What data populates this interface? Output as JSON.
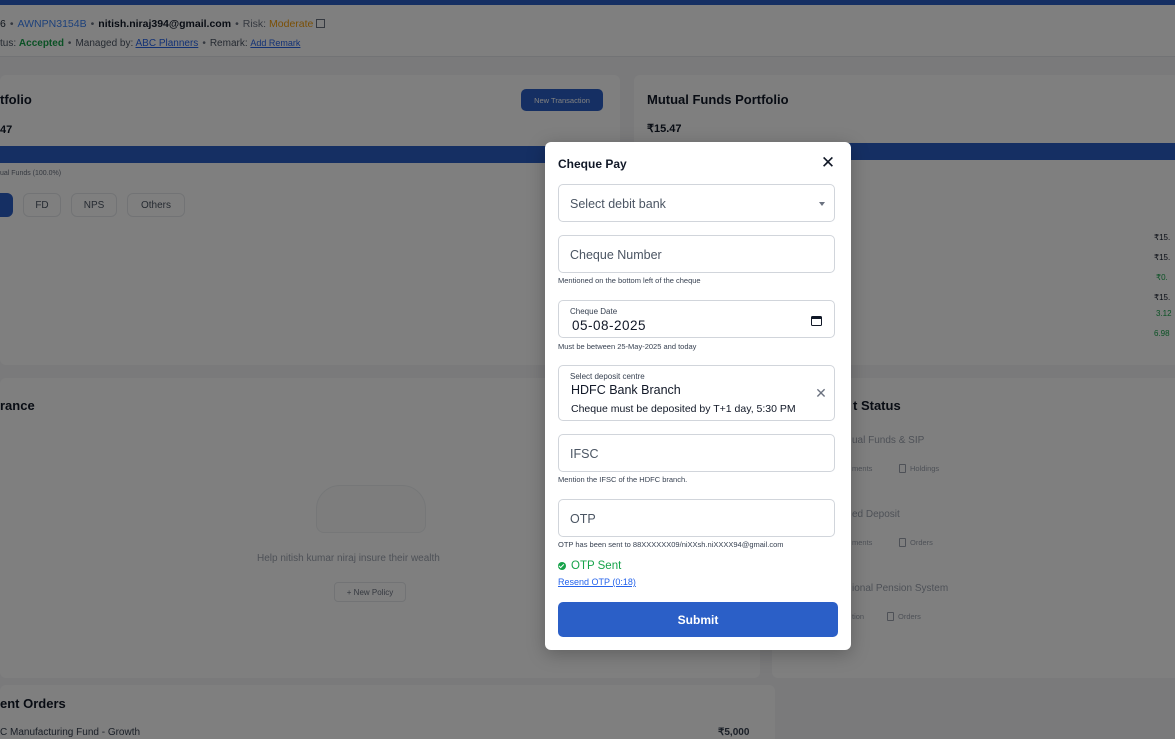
{
  "client": {
    "id_fragment": "6",
    "pan": "AWNPN3154B",
    "email": "nitish.niraj394@gmail.com",
    "risk_label": "Risk:",
    "risk_value": "Moderate",
    "status_label": "tus:",
    "status_value": "Accepted",
    "managed_by_label": "Managed by:",
    "managed_by_value": "ABC Planners",
    "remark_label": "Remark:",
    "remark_link": "Add Remark"
  },
  "portfolio": {
    "title": "tfolio",
    "amount": "47",
    "new_transaction": "New Transaction",
    "legend": "ual Funds (100.0%)",
    "allocation_fraction": 1.0,
    "tabs": [
      "FD",
      "NPS",
      "Others"
    ]
  },
  "mf_portfolio": {
    "title": "Mutual Funds Portfolio",
    "amount": "₹15.47",
    "values": [
      "₹15.",
      "₹15.",
      "₹0.",
      "₹15.",
      "3.12",
      "6.98"
    ]
  },
  "insurance": {
    "title": "rance",
    "empty_text": "Help nitish kumar niraj insure their wealth",
    "new_policy": "+ New Policy"
  },
  "account_status": {
    "title": "t Status",
    "items": [
      {
        "name": "ual Funds & SIP",
        "link1": "ments",
        "link2": "Holdings"
      },
      {
        "name": "ed Deposit",
        "link1": "ments",
        "link2": "Orders"
      },
      {
        "name": "ional Pension System",
        "link1": "tion",
        "link2": "Orders"
      }
    ]
  },
  "orders": {
    "title": "ent Orders",
    "row_fund": "C Manufacturing Fund - Growth",
    "row_amount": "₹5,000"
  },
  "modal": {
    "title": "Cheque Pay",
    "debit_bank_placeholder": "Select debit bank",
    "cheque_number_placeholder": "Cheque Number",
    "cheque_number_helper": "Mentioned on the bottom left of the cheque",
    "cheque_date_label": "Cheque Date",
    "cheque_date_value": "05-08-2025",
    "cheque_date_helper": "Must be between 25-May-2025 and today",
    "deposit_centre_label": "Select deposit centre",
    "deposit_centre_value": "HDFC Bank Branch",
    "deposit_centre_note": "Cheque must be deposited by T+1 day, 5:30 PM",
    "ifsc_placeholder": "IFSC",
    "ifsc_helper": "Mention the IFSC of the HDFC branch.",
    "otp_placeholder": "OTP",
    "otp_helper": "OTP has been sent to 88XXXXXX09/niXXsh.niXXXX94@gmail.com",
    "otp_status": "OTP Sent",
    "resend_otp": "Resend OTP (0:18)",
    "submit": "Submit"
  },
  "colors": {
    "accent": "#2b5fc7",
    "success": "#16a34a",
    "warning": "#f59e0b"
  }
}
